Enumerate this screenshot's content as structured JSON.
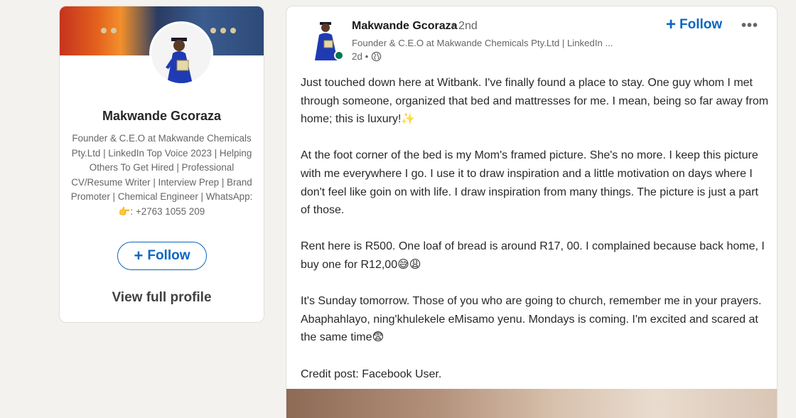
{
  "profile_card": {
    "name": "Makwande Gcoraza",
    "headline": "Founder & C.E.O at Makwande Chemicals Pty.Ltd | LinkedIn Top Voice 2023 | Helping Others To Get Hired | Professional CV/Resume Writer | Interview Prep | Brand Promoter | Chemical Engineer | WhatsApp: 👉: +2763 1055 209",
    "follow_label": "Follow",
    "view_profile_label": "View full profile"
  },
  "post": {
    "author_name": "Makwande Gcoraza",
    "degree": "• 2nd",
    "author_headline": "Founder & C.E.O at Makwande Chemicals Pty.Ltd | LinkedIn ...",
    "time": "2d •",
    "follow_label": "Follow",
    "more_label": "•••",
    "paragraphs": [
      "Just touched down here at Witbank. I've finally found a place to stay. One guy whom I met through someone, organized that bed and mattresses for me. I mean, being so far away from home; this is luxury!✨",
      "At the foot corner of the bed is my Mom's framed picture. She's no more. I keep this picture with me everywhere I go. I use it to draw inspiration and a little motivation on days where I don't feel like goin on with life. I draw inspiration from many things. The picture is just a part of those.",
      "Rent here is R500. One loaf of bread is around R17, 00. I complained because back home, I buy one for R12,00😅😩",
      "It's Sunday tomorrow. Those of you who are going to church, remember me in your prayers. Abaphahlayo, ning'khulekele eMisamo yenu. Mondays is coming. I'm excited and scared at the same time😨",
      "Credit post: Facebook User."
    ]
  },
  "colors": {
    "brand_blue": "#0a66c2",
    "online_green": "#01754f",
    "background": "#f3f2ef"
  },
  "icons": {
    "plus": "plus-icon",
    "globe": "globe-icon",
    "more": "more-options-icon"
  }
}
